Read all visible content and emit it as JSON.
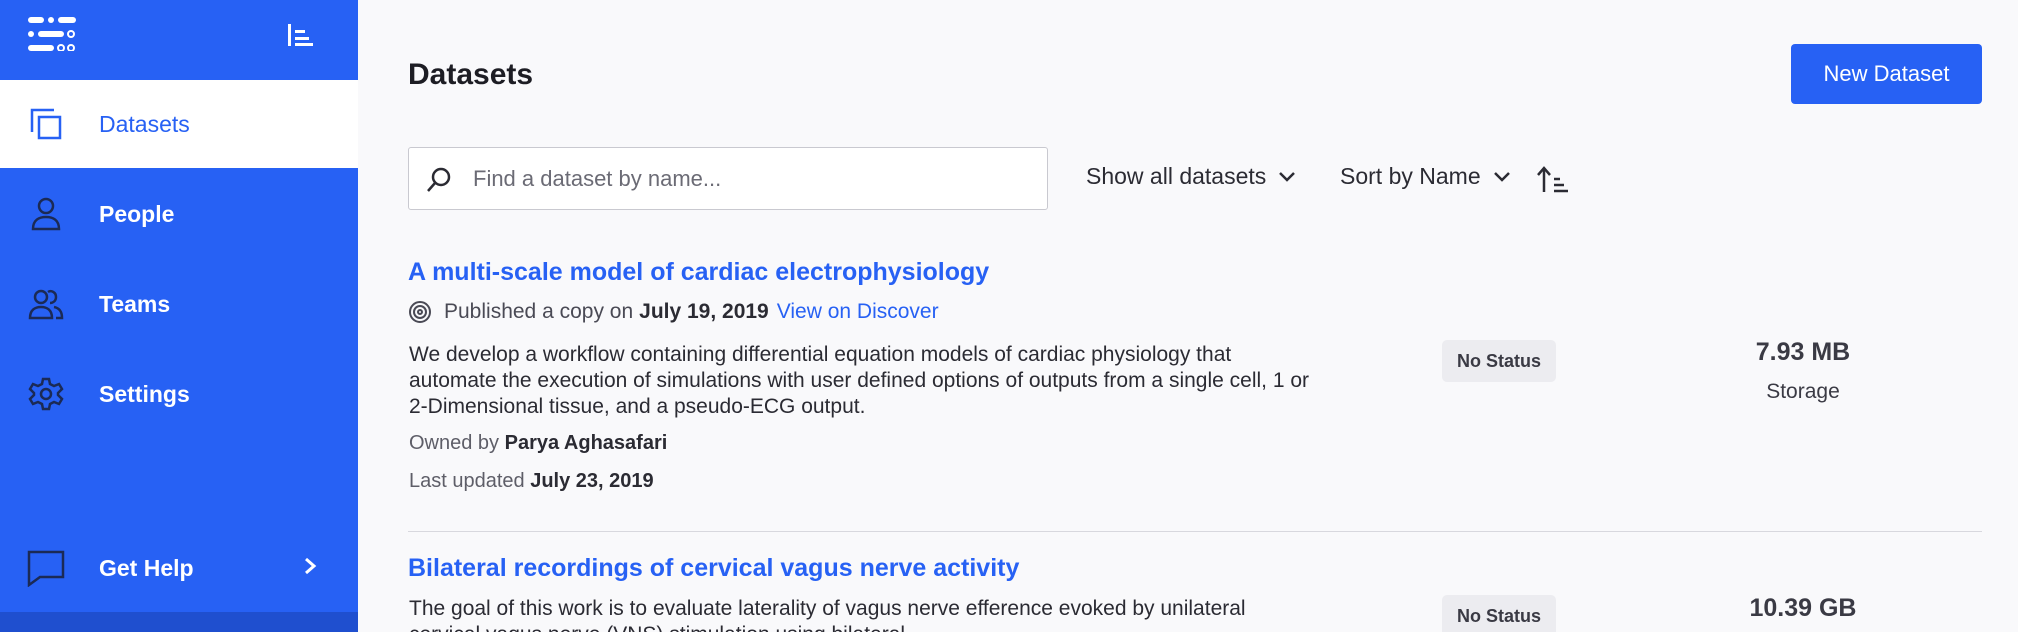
{
  "sidebar": {
    "items": [
      {
        "label": "Datasets",
        "icon": "datasets-icon",
        "active": true
      },
      {
        "label": "People",
        "icon": "person-icon",
        "active": false
      },
      {
        "label": "Teams",
        "icon": "team-icon",
        "active": false
      },
      {
        "label": "Settings",
        "icon": "gear-icon",
        "active": false
      }
    ],
    "help": {
      "label": "Get Help",
      "icon": "chat-icon"
    }
  },
  "header": {
    "title": "Datasets",
    "new_button_label": "New Dataset"
  },
  "search": {
    "placeholder": "Find a dataset by name...",
    "value": ""
  },
  "filters": {
    "show_label": "Show all datasets",
    "sort_label": "Sort by Name"
  },
  "datasets": [
    {
      "title": "A multi-scale model of cardiac electrophysiology",
      "published_prefix": "Published a copy on",
      "published_date": "July 19, 2019",
      "discover_link": "View on Discover",
      "description": "We develop a workflow containing differential equation models of cardiac physiology that automate the execution of simulations with user defined options of outputs from a single cell, 1 or 2-Dimensional tissue, and a pseudo-ECG output.",
      "owner_prefix": "Owned by",
      "owner": "Parya Aghasafari",
      "updated_prefix": "Last updated",
      "updated": "July 23, 2019",
      "status": "No Status",
      "storage_value": "7.93 MB",
      "storage_label": "Storage"
    },
    {
      "title": "Bilateral recordings of cervical vagus nerve activity",
      "description": "The goal of this work is to evaluate laterality of vagus nerve efference evoked by unilateral cervical vagus nerve (VNS) stimulation using bilateral",
      "status": "No Status",
      "storage_value": "10.39 GB"
    }
  ],
  "colors": {
    "brand": "#2761f4",
    "background": "#f9f9fb",
    "badge": "#ececf0"
  }
}
